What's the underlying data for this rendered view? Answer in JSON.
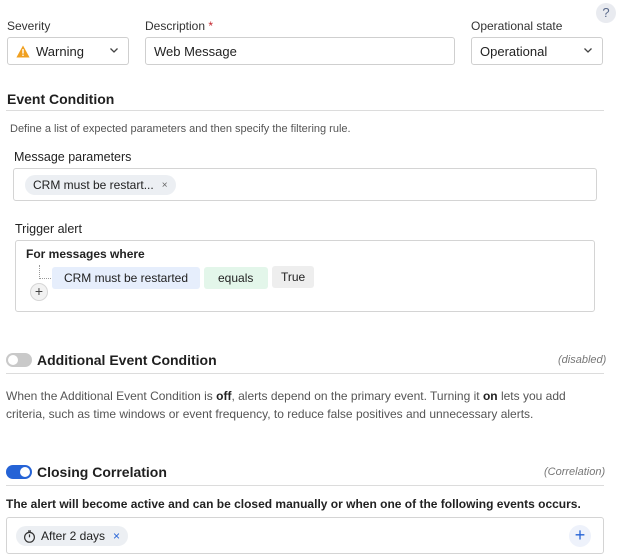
{
  "top": {
    "severity_label": "Severity",
    "severity_value": "Warning",
    "description_label": "Description",
    "description_required": "*",
    "description_value": "Web Message",
    "op_state_label": "Operational state",
    "op_state_value": "Operational",
    "help": "?"
  },
  "event_condition": {
    "title": "Event Condition",
    "description": "Define a list of expected parameters and then specify the filtering rule.",
    "message_parameters_label": "Message parameters",
    "message_chip": "CRM must be restart...",
    "chip_remove": "×",
    "trigger_alert_label": "Trigger alert",
    "for_messages_where": "For messages where",
    "add": "+",
    "rule": {
      "parameter": "CRM must be restarted",
      "operator": "equals",
      "value": "True"
    }
  },
  "additional_condition": {
    "title": "Additional Event Condition",
    "status": "(disabled)",
    "enabled": false,
    "text": "When the Additional Event Condition is off, alerts depend on the primary event. Turning it on lets you add criteria, such as time windows or event frequency, to reduce false positives and unnecessary alerts.",
    "text_parts": {
      "p1": "When the Additional Event Condition is ",
      "b1": "off",
      "p2": ", alerts depend on the primary event. Turning it ",
      "b2": "on",
      "p3": " lets you add criteria, such as time windows or event frequency, to reduce false positives and unnecessary alerts."
    }
  },
  "closing_correlation": {
    "title": "Closing Correlation",
    "status": "(Correlation)",
    "enabled": true,
    "note": "The alert will become active and can be closed manually or when one of the following events occurs.",
    "chip": "After 2 days",
    "chip_remove": "×",
    "add": "+"
  },
  "colors": {
    "accent": "#2563d6",
    "warning": "#f0a020",
    "operator_bg": "#e3f6ea",
    "parameter_bg": "#e6eefc",
    "value_bg": "#eeeeee"
  }
}
